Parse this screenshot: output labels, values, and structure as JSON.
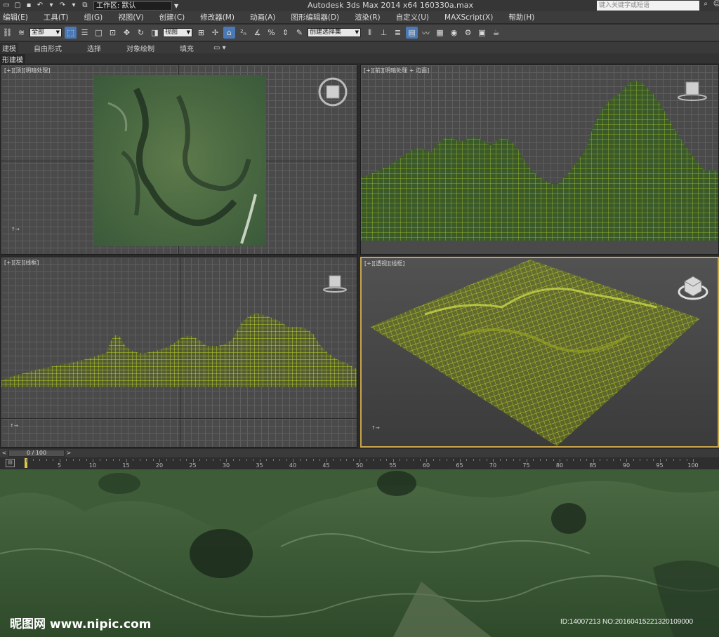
{
  "titlebar": {
    "workspace_label": "工作区: 默认",
    "app_title": "Autodesk 3ds Max  2014 x64     160330a.max",
    "search_placeholder": "键入关键字或短语"
  },
  "menu": [
    "编辑(E)",
    "工具(T)",
    "组(G)",
    "视图(V)",
    "创建(C)",
    "修改器(M)",
    "动画(A)",
    "图形编辑器(D)",
    "渲染(R)",
    "自定义(U)",
    "MAXScript(X)",
    "帮助(H)"
  ],
  "toolbar": {
    "selection_filter": "全部",
    "ref_coord": "视图",
    "named_selection": "创建选择集"
  },
  "ribbon": {
    "tabs": [
      "建模",
      "自由形式",
      "选择",
      "对象绘制",
      "填充"
    ],
    "sub_label": "形建模"
  },
  "viewports": {
    "top": {
      "label": "[+][顶][明暗处理]"
    },
    "front": {
      "label": "[+][前][明暗处理 + 边面]"
    },
    "left": {
      "label": "[+][左][线框]"
    },
    "perspective": {
      "label": "[+][透视][线框]"
    }
  },
  "timeline": {
    "frame_counter": "0 / 100",
    "ticks": [
      "5",
      "10",
      "15",
      "20",
      "25",
      "30",
      "35",
      "40",
      "45",
      "50",
      "55",
      "60",
      "65",
      "70",
      "75",
      "80",
      "85",
      "90",
      "95",
      "100"
    ]
  },
  "footer": {
    "watermark": "昵图网 www.nipic.com",
    "image_id": "ID:14007213 NO:20160415221320109000"
  },
  "colors": {
    "wire": "#b7cc2a",
    "terrain": "#3f5a34",
    "active_border": "#c9a54a"
  }
}
